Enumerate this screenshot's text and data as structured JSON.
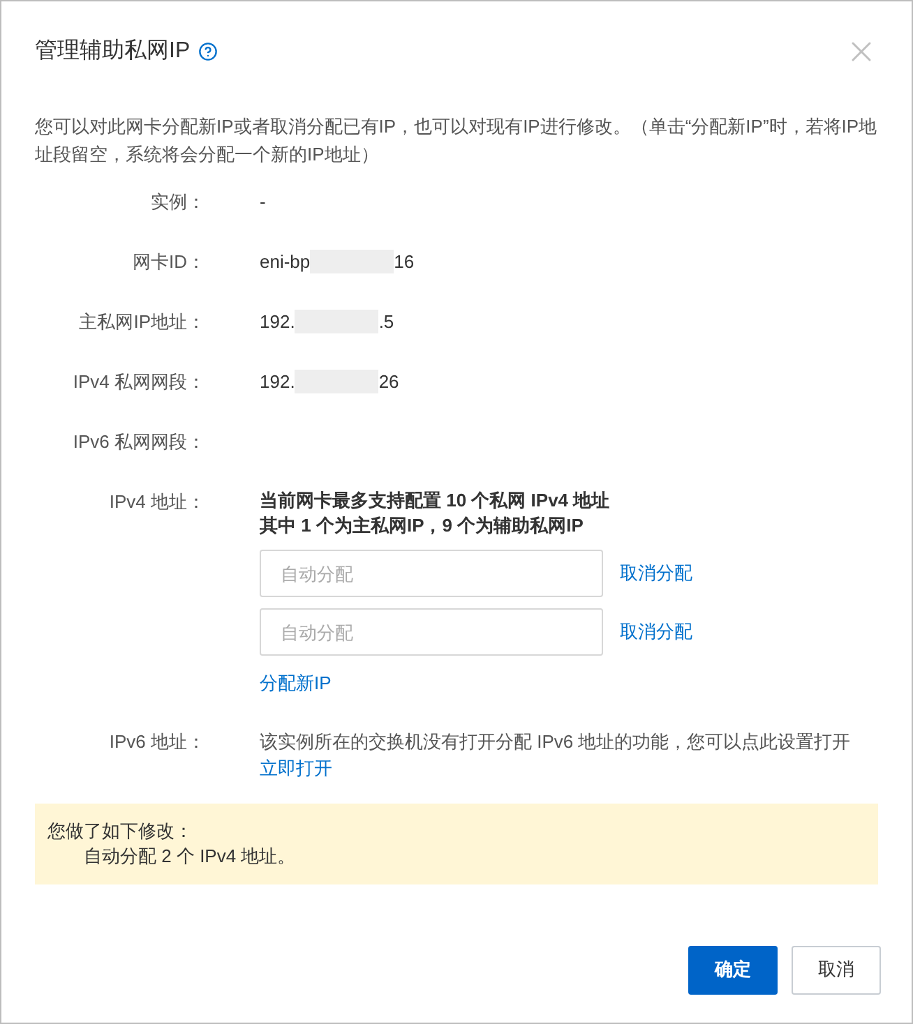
{
  "dialog": {
    "title": "管理辅助私网IP",
    "description": "您可以对此网卡分配新IP或者取消分配已有IP，也可以对现有IP进行修改。（单击“分配新IP”时，若将IP地址段留空，系统将会分配一个新的IP地址）"
  },
  "fields": [
    {
      "label": "实例：",
      "kind": "text",
      "value": "-"
    },
    {
      "label": "网卡ID：",
      "kind": "masked",
      "prefix": "eni-bp",
      "suffix": "16"
    },
    {
      "label": "主私网IP地址：",
      "kind": "masked",
      "prefix": "192.",
      "suffix": ".5"
    },
    {
      "label": "IPv4 私网网段：",
      "kind": "masked",
      "prefix": "192.",
      "suffix": "26"
    },
    {
      "label": "IPv6 私网网段：",
      "kind": "empty"
    }
  ],
  "ipv4": {
    "label": "IPv4 地址：",
    "notes": [
      "当前网卡最多支持配置 10 个私网 IPv4 地址",
      "其中 1 个为主私网IP，9 个为辅助私网IP"
    ],
    "inputs": [
      {
        "placeholder": "自动分配",
        "action": "取消分配"
      },
      {
        "placeholder": "自动分配",
        "action": "取消分配"
      }
    ],
    "add_link": "分配新IP"
  },
  "ipv6": {
    "label": "IPv6 地址：",
    "text": "该实例所在的交换机没有打开分配 IPv6 地址的功能，您可以点此设置打开",
    "link": "立即打开"
  },
  "changes": {
    "title": "您做了如下修改：",
    "items": [
      "自动分配 2 个 IPv4 地址。"
    ]
  },
  "buttons": [
    {
      "label": "确定",
      "kind": "primary"
    },
    {
      "label": "取消",
      "kind": "secondary"
    }
  ]
}
